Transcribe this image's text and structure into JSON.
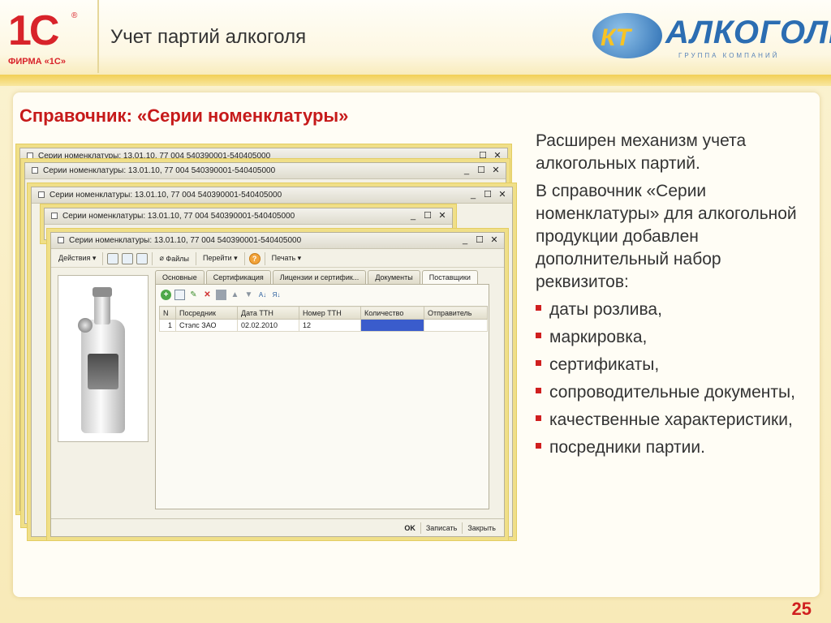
{
  "header": {
    "logo_1c_mark": "1С",
    "logo_1c_reg": "®",
    "logo_1c_text": "ФИРМА «1С»",
    "title": "Учет партий алкоголя",
    "brand_logo_mark": "КТ",
    "brand_logo_word": "АЛКОГОЛЬ",
    "brand_logo_sub": "ГРУППА КОМПАНИЙ"
  },
  "slide": {
    "heading": "Справочник: «Серии номенклатуры»",
    "page_number": "25"
  },
  "windows": {
    "title_back_1": "Серии номенклатуры: 13.01.10, 77 004 540390001-540405000",
    "title_back_2": "Серии номенклатуры: 13.01.10, 77 004 540390001-540405000",
    "title_back_3": "Серии номенклатуры: 13.01.10, 77 004 540390001-540405000",
    "title_back_4": "Серии номенклатуры: 13.01.10, 77 004 540390001-540405000",
    "title_front": "Серии номенклатуры: 13.01.10, 77 004 540390001-540405000",
    "controls": {
      "minimize": "_",
      "maximize": "☐",
      "close": "✕"
    }
  },
  "toolbar": {
    "actions": "Действия ▾",
    "files": "Файлы",
    "goto": "Перейти ▾",
    "help": "?",
    "print": "Печать ▾"
  },
  "tabs": [
    "Основные",
    "Сертификация",
    "Лицензии и сертифик...",
    "Документы",
    "Поставщики"
  ],
  "active_tab": "Поставщики",
  "table": {
    "columns": [
      "N",
      "Посредник",
      "Дата ТТН",
      "Номер ТТН",
      "Количество",
      "Отправитель"
    ],
    "rows": [
      {
        "n": "1",
        "intermediary": "Стэлс ЗАО",
        "ttn_date": "02.02.2010",
        "ttn_number": "12",
        "quantity": "",
        "sender": ""
      }
    ]
  },
  "bottom_buttons": {
    "ok": "OK",
    "save": "Записать",
    "close": "Закрыть"
  },
  "description": {
    "intro": "Расширен механизм учета алкогольных партий.",
    "text": "В справочник «Серии номенклатуры» для алкогольной продукции добавлен дополнительный набор реквизитов:",
    "items": [
      "даты розлива,",
      "маркировка,",
      "сертификаты,",
      "сопроводительные документы,",
      "качественные характеристики,",
      "посредники партии."
    ]
  },
  "colors": {
    "accent_red": "#d01f1f",
    "brand_blue": "#2b6db2",
    "brand_yellow": "#f7c325",
    "selection_blue": "#3a5ccc"
  }
}
